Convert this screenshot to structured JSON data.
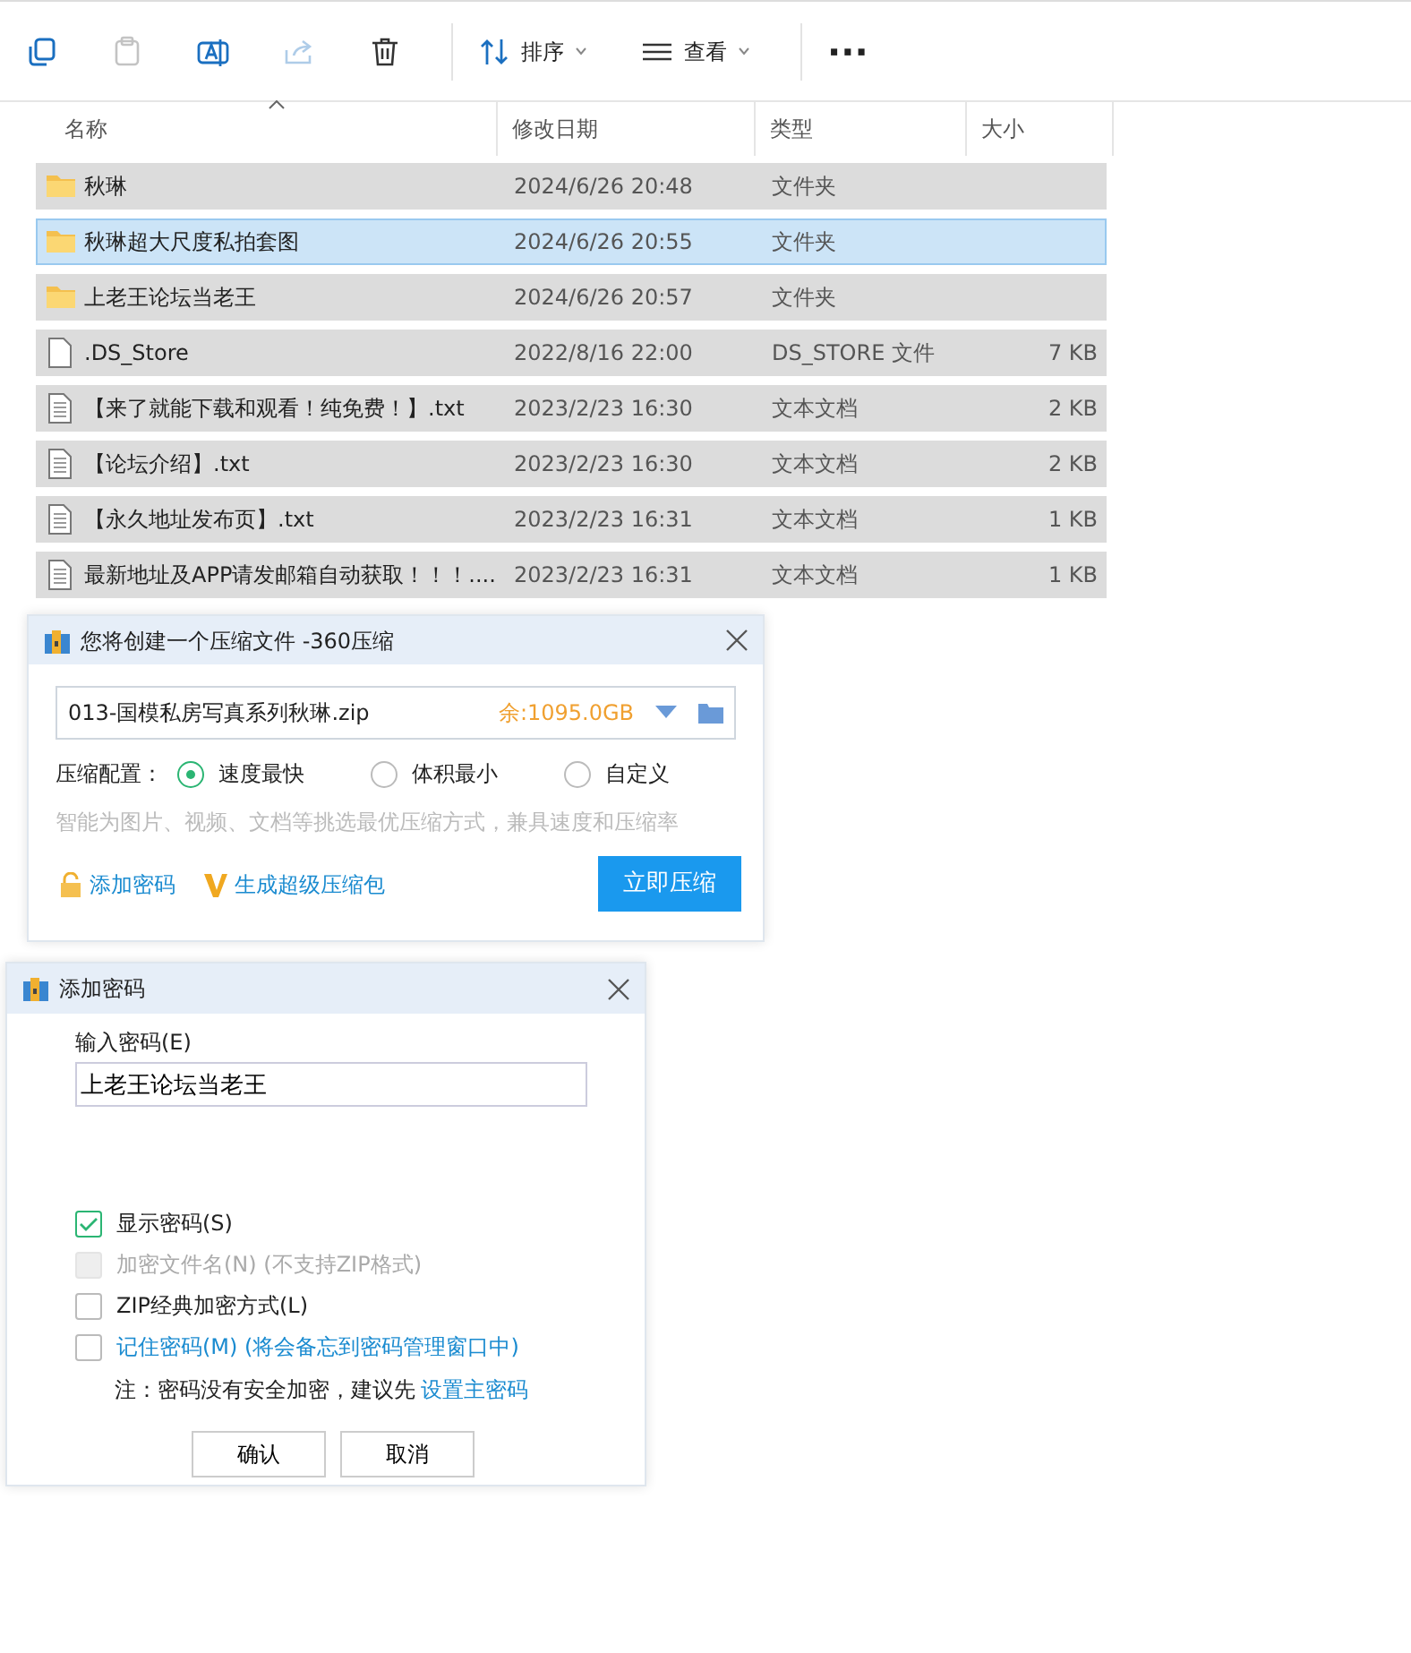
{
  "toolbar": {
    "items": [
      {
        "kind": "copy",
        "disabled": false
      },
      {
        "kind": "paste",
        "disabled": true
      },
      {
        "kind": "rename",
        "disabled": false
      },
      {
        "kind": "share",
        "disabled": true
      },
      {
        "kind": "delete",
        "disabled": false
      },
      {
        "kind": "sort",
        "label": "排序",
        "disabled": false
      },
      {
        "kind": "view",
        "label": "查看",
        "disabled": false
      },
      {
        "kind": "more",
        "label": "···",
        "disabled": false
      }
    ]
  },
  "table": {
    "columns": [
      "名称",
      "修改日期",
      "类型",
      "大小"
    ],
    "rows": [
      {
        "kind": "folder",
        "name": "秋琳",
        "date": "2024/6/26 20:48",
        "type": "文件夹",
        "selected": false
      },
      {
        "kind": "folder",
        "name": "秋琳超大尺度私拍套图",
        "date": "2024/6/26 20:55",
        "type": "文件夹",
        "selected": true
      },
      {
        "kind": "folder",
        "name": "上老王论坛当老王",
        "date": "2024/6/26 20:57",
        "type": "文件夹",
        "selected": false
      },
      {
        "kind": "file",
        "name": ".DS_Store",
        "date": "2022/8/16 22:00",
        "type": "DS_STORE 文件",
        "size": "7 KB",
        "selected": false
      },
      {
        "kind": "text",
        "name": "【来了就能下载和观看！纯免费！】.txt",
        "date": "2023/2/23 16:30",
        "type": "文本文档",
        "size": "2 KB",
        "selected": false
      },
      {
        "kind": "text",
        "name": "【论坛介绍】.txt",
        "date": "2023/2/23 16:30",
        "type": "文本文档",
        "size": "2 KB",
        "selected": false
      },
      {
        "kind": "text",
        "name": "【永久地址发布页】.txt",
        "date": "2023/2/23 16:31",
        "type": "文本文档",
        "size": "1 KB",
        "selected": false
      },
      {
        "kind": "text",
        "name": "最新地址及APP请发邮箱自动获取！！！....",
        "date": "2023/2/23 16:31",
        "type": "文本文档",
        "size": "1 KB",
        "selected": false
      }
    ]
  },
  "compress_dialog": {
    "title": "您将创建一个压缩文件 -360压缩",
    "filename": "013-国模私房写真系列秋琳.zip",
    "free_space": "余:1095.0GB",
    "config_label": "压缩配置：",
    "options": [
      {
        "label": "速度最快",
        "selected": true
      },
      {
        "label": "体积最小",
        "selected": false
      },
      {
        "label": "自定义",
        "selected": false
      }
    ],
    "hint": "智能为图片、视频、文档等挑选最优压缩方式，兼具速度和压缩率",
    "add_password": "添加密码",
    "super_pack": "生成超级压缩包",
    "compress_button": "立即压缩"
  },
  "password_dialog": {
    "title": "添加密码",
    "field_label": "输入密码(E)",
    "value": "上老王论坛当老王",
    "options": [
      {
        "kind": "plain",
        "label": "显示密码(S)",
        "checked": true,
        "disabled": false
      },
      {
        "kind": "plain",
        "label": "加密文件名(N) (不支持ZIP格式)",
        "checked": false,
        "disabled": true
      },
      {
        "kind": "plain",
        "label": "ZIP经典加密方式(L)",
        "checked": false,
        "disabled": false
      },
      {
        "kind": "link",
        "label": "记住密码(M) (将会备忘到密码管理窗口中)",
        "checked": false,
        "disabled": false
      }
    ],
    "note": "注：密码没有安全加密，建议先",
    "note_link": "设置主密码",
    "buttons": [
      "确认",
      "取消"
    ]
  }
}
